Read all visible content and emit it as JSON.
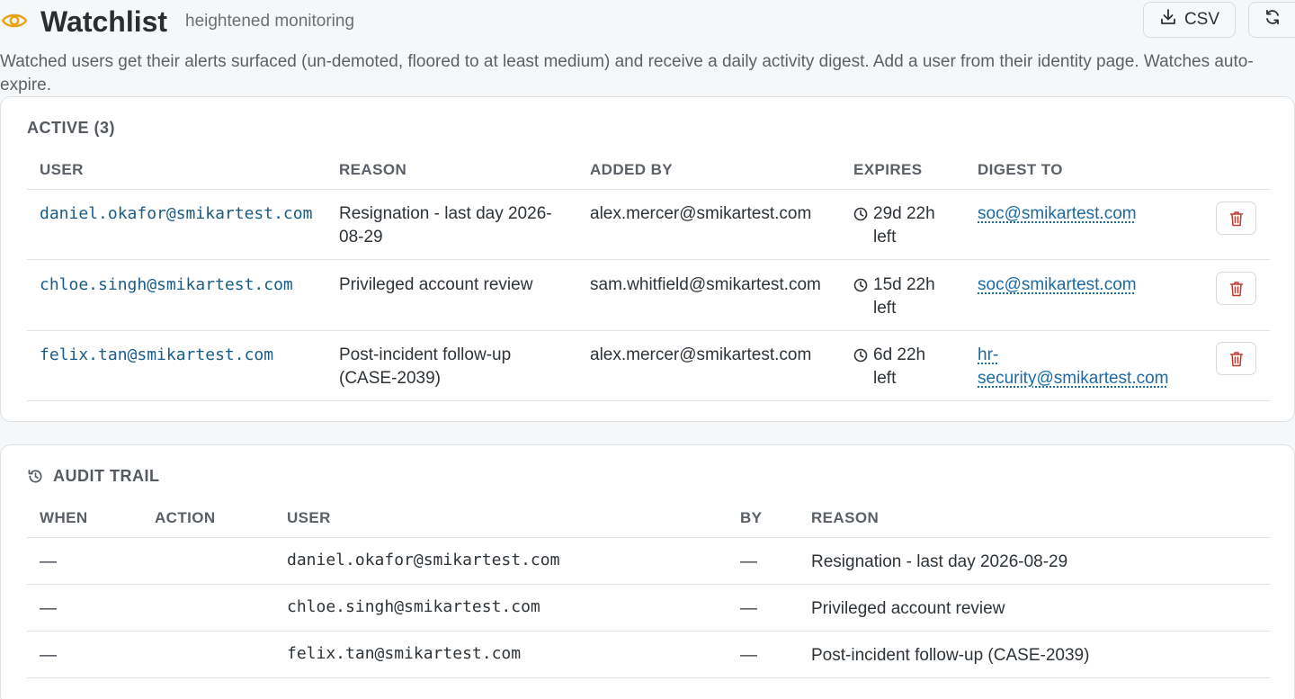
{
  "header": {
    "title": "Watchlist",
    "subtitle": "heightened monitoring",
    "csv_label": "CSV",
    "description": "Watched users get their alerts surfaced (un-demoted, floored to at least medium) and receive a daily activity digest. Add a user from their identity page. Watches auto-expire."
  },
  "active": {
    "title": "ACTIVE (3)",
    "columns": [
      "USER",
      "REASON",
      "ADDED BY",
      "EXPIRES",
      "DIGEST TO"
    ],
    "rows": [
      {
        "user": "daniel.okafor@smikartest.com",
        "reason": "Resignation - last day 2026-08-29",
        "added_by": "alex.mercer@smikartest.com",
        "expires": "29d 22h left",
        "digest_to": "soc@smikartest.com"
      },
      {
        "user": "chloe.singh@smikartest.com",
        "reason": "Privileged account review",
        "added_by": "sam.whitfield@smikartest.com",
        "expires": "15d 22h left",
        "digest_to": "soc@smikartest.com"
      },
      {
        "user": "felix.tan@smikartest.com",
        "reason": "Post-incident follow-up (CASE-2039)",
        "added_by": "alex.mercer@smikartest.com",
        "expires": "6d 22h left",
        "digest_to": "hr-security@smikartest.com"
      }
    ]
  },
  "audit": {
    "title": "AUDIT TRAIL",
    "columns": [
      "WHEN",
      "ACTION",
      "USER",
      "BY",
      "REASON"
    ],
    "rows": [
      {
        "when": "—",
        "action": "",
        "user": "daniel.okafor@smikartest.com",
        "by": "—",
        "reason": "Resignation - last day 2026-08-29"
      },
      {
        "when": "—",
        "action": "",
        "user": "chloe.singh@smikartest.com",
        "by": "—",
        "reason": "Privileged account review"
      },
      {
        "when": "—",
        "action": "",
        "user": "felix.tan@smikartest.com",
        "by": "—",
        "reason": "Post-incident follow-up (CASE-2039)"
      }
    ]
  },
  "colors": {
    "accent_eye": "#e8a317",
    "link": "#1a5c86",
    "delete": "#c0392b"
  },
  "icons": {
    "header": "eye-icon",
    "csv": "download-icon",
    "refresh": "refresh-icon",
    "expires": "clock-icon",
    "delete": "trash-icon",
    "audit": "history-icon"
  }
}
